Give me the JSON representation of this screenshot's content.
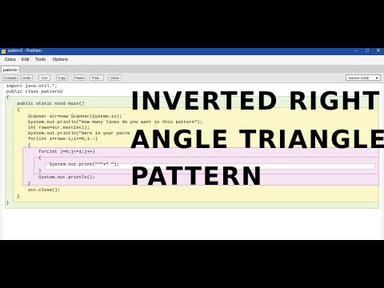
{
  "window": {
    "title": "pattern2 - Pratham"
  },
  "menu": [
    "Class",
    "Edit",
    "Tools",
    "Options"
  ],
  "tab": {
    "label": "pattern2",
    "close": "×"
  },
  "toolbar": {
    "buttons": [
      "Compile",
      "Undo",
      "Cut",
      "Copy",
      "Paste",
      "Find...",
      "Close"
    ],
    "view": "Source Code"
  },
  "code": [
    "import java.util.*;",
    "public class pattern2",
    "{",
    "    public static void main()",
    "    {",
    "        Scanner scr=new Scanner(System.in);",
    "        System.out.println(\"How many lines do you want in this pattern\");",
    "        int rows=scr.nextInt();",
    "        System.out.println(\"Here is your patte",
    "        for(int i=rows-1;i>=0;i--)",
    "        {",
    "            for(int j=0;j<=i;j++)",
    "            {",
    "                System.out.print(\"*\"+\" \");",
    "            }",
    "            System.out.println();",
    "        }",
    "        scr.close();",
    "    }",
    "}"
  ],
  "overlay": [
    "INVERTED RIGHT",
    "ANGLE TRIANGLE",
    "PATTERN"
  ],
  "colors": {
    "titlebar": "#1e4ba0",
    "class_scope": "#e8f4dc",
    "method_scope": "#fbf7c8",
    "loop_scope": "#f7e4f2"
  }
}
